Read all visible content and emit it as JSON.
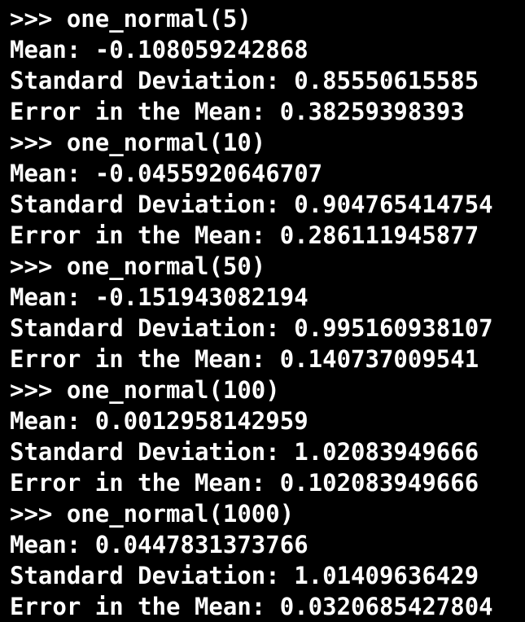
{
  "terminal": {
    "lines": [
      ">>> one_normal(5)",
      "Mean: -0.108059242868",
      "Standard Deviation: 0.85550615585",
      "Error in the Mean: 0.38259398393",
      ">>> one_normal(10)",
      "Mean: -0.0455920646707",
      "Standard Deviation: 0.904765414754",
      "Error in the Mean: 0.286111945877",
      ">>> one_normal(50)",
      "Mean: -0.151943082194",
      "Standard Deviation: 0.995160938107",
      "Error in the Mean: 0.140737009541",
      ">>> one_normal(100)",
      "Mean: 0.0012958142959",
      "Standard Deviation: 1.02083949666",
      "Error in the Mean: 0.102083949666",
      ">>> one_normal(1000)",
      "Mean: 0.0447831373766",
      "Standard Deviation: 1.01409636429",
      "Error in the Mean: 0.0320685427804"
    ]
  }
}
